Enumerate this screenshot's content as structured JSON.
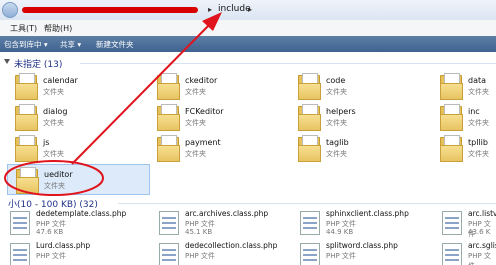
{
  "address": {
    "crumb": "include",
    "sep_before": "▸",
    "sep_after": "▸"
  },
  "menu": {
    "tools": "工具(T)",
    "help": "帮助(H)"
  },
  "toolbar": {
    "include_in_library": "包含到库中 ▾",
    "share": "共享 ▾",
    "new_folder": "新建文件夹"
  },
  "groups": {
    "unspecified": "未指定 (13)",
    "small": "小(10 - 100 KB) (32)"
  },
  "folder_type": "文件夹",
  "folders": [
    {
      "name": "calendar"
    },
    {
      "name": "ckeditor"
    },
    {
      "name": "code"
    },
    {
      "name": "data"
    },
    {
      "name": "dialog"
    },
    {
      "name": "FCKeditor"
    },
    {
      "name": "helpers"
    },
    {
      "name": "inc"
    },
    {
      "name": "js"
    },
    {
      "name": "payment"
    },
    {
      "name": "taglib"
    },
    {
      "name": "tpllib"
    },
    {
      "name": "ueditor"
    }
  ],
  "files": [
    {
      "name": "dedetemplate.class.php",
      "type": "PHP 文件",
      "size": "47.6 KB"
    },
    {
      "name": "arc.archives.class.php",
      "type": "PHP 文件",
      "size": "45.1 KB"
    },
    {
      "name": "sphinxclient.class.php",
      "type": "PHP 文件",
      "size": "44.9 KB"
    },
    {
      "name": "arc.listvie",
      "type": "PHP 文件",
      "size": "43.6 K"
    },
    {
      "name": "Lurd.class.php",
      "type": "PHP 文件",
      "size": ""
    },
    {
      "name": "dedecollection.class.php",
      "type": "PHP 文件",
      "size": ""
    },
    {
      "name": "splitword.class.php",
      "type": "PHP 文件",
      "size": ""
    },
    {
      "name": "arc.sglist",
      "type": "PHP 文件",
      "size": ""
    }
  ],
  "colors": {
    "annotation": "#e0141c",
    "selection": "#dceaf9",
    "group_title": "#1e3287"
  }
}
